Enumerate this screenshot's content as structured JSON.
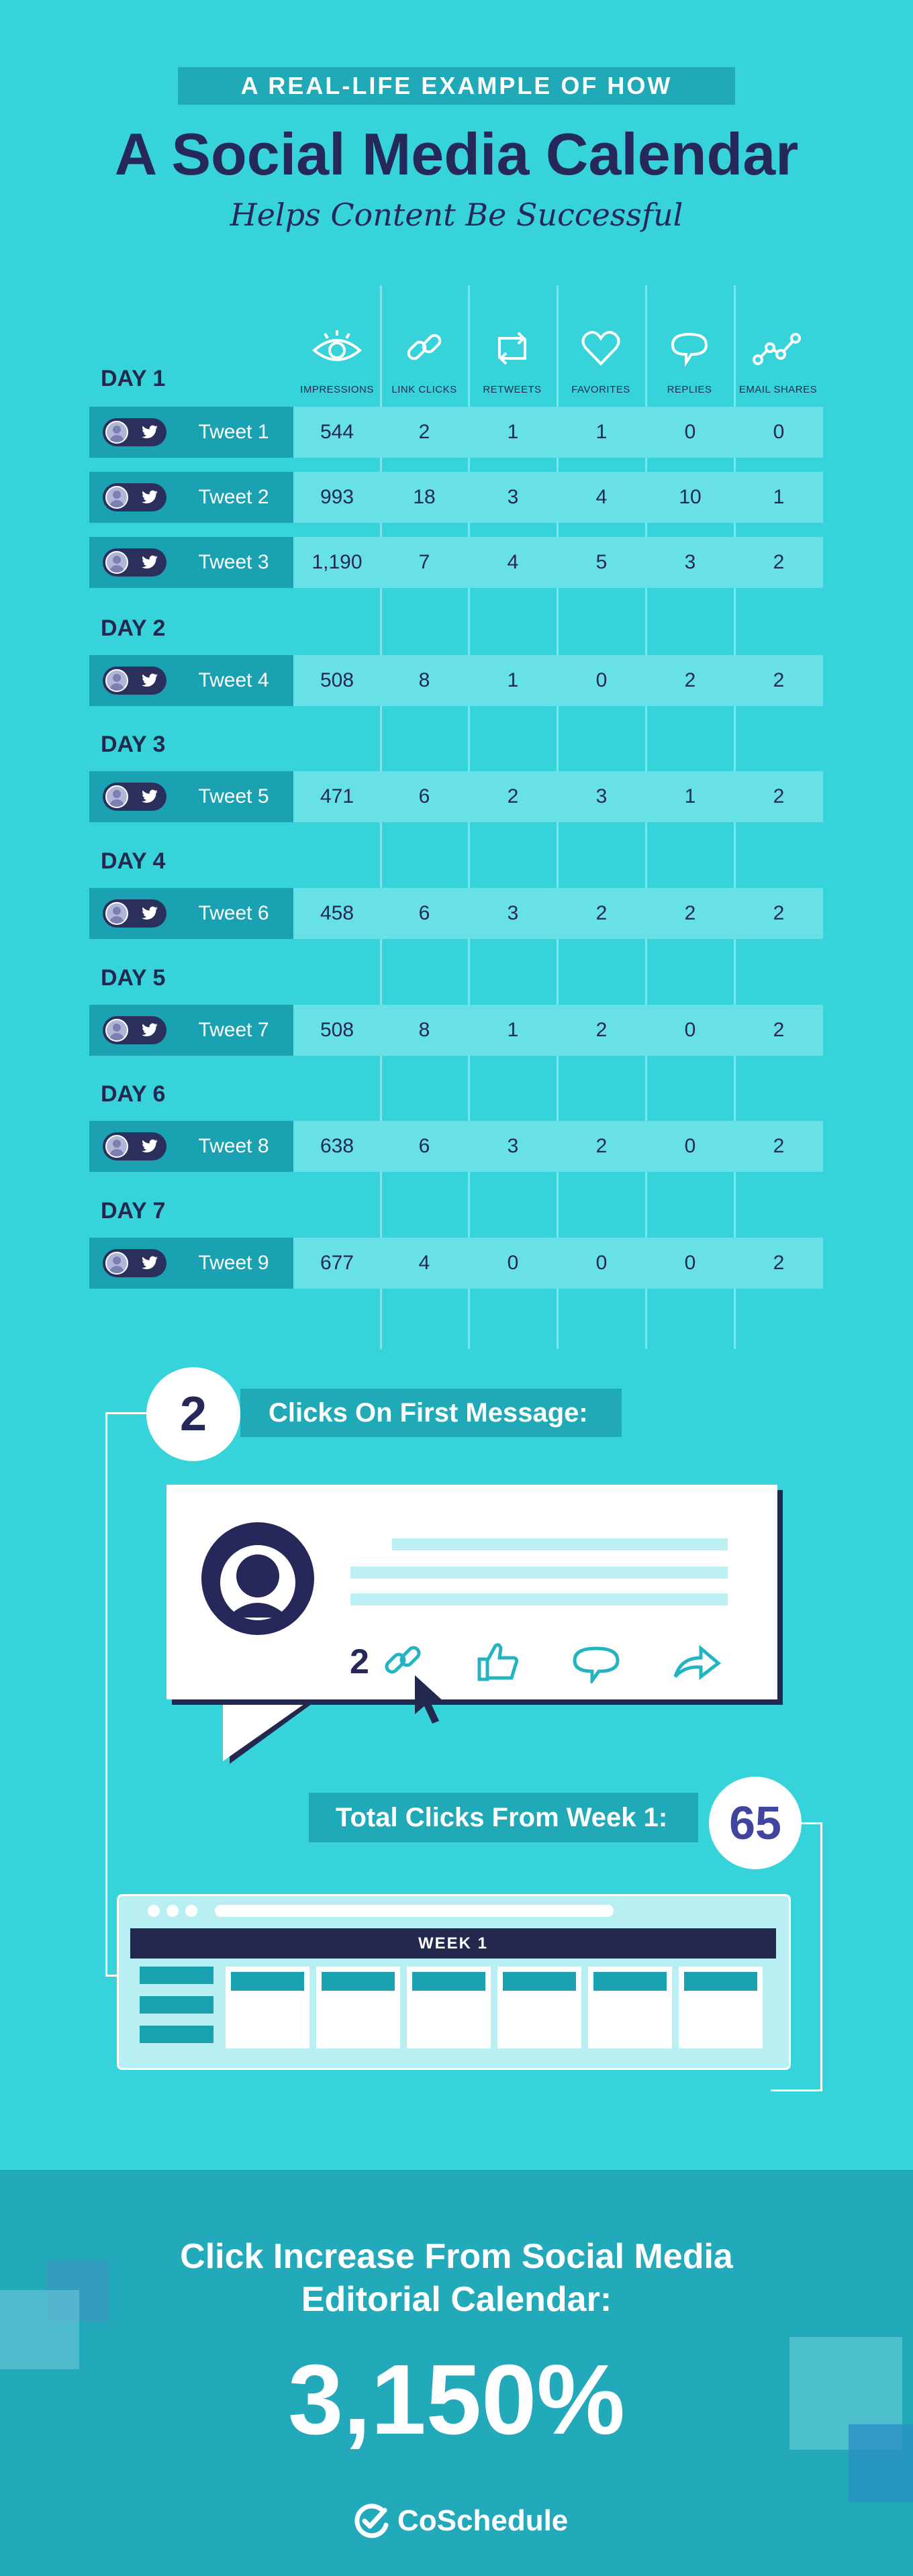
{
  "header": {
    "banner": "A REAL-LIFE EXAMPLE OF HOW",
    "title": "A Social Media Calendar",
    "subtitle": "Helps Content Be Successful"
  },
  "columns": [
    {
      "label": "IMPRESSIONS",
      "icon": "eye-icon"
    },
    {
      "label": "LINK CLICKS",
      "icon": "link-icon"
    },
    {
      "label": "RETWEETS",
      "icon": "retweet-icon"
    },
    {
      "label": "FAVORITES",
      "icon": "heart-icon"
    },
    {
      "label": "REPLIES",
      "icon": "speech-bubble-icon"
    },
    {
      "label": "EMAIL SHARES",
      "icon": "share-graph-icon"
    }
  ],
  "days": [
    {
      "label": "DAY 1",
      "tweets": [
        {
          "name": "Tweet 1",
          "values": [
            "544",
            "2",
            "1",
            "1",
            "0",
            "0"
          ]
        },
        {
          "name": "Tweet 2",
          "values": [
            "993",
            "18",
            "3",
            "4",
            "10",
            "1"
          ]
        },
        {
          "name": "Tweet 3",
          "values": [
            "1,190",
            "7",
            "4",
            "5",
            "3",
            "2"
          ]
        }
      ]
    },
    {
      "label": "DAY 2",
      "tweets": [
        {
          "name": "Tweet 4",
          "values": [
            "508",
            "8",
            "1",
            "0",
            "2",
            "2"
          ]
        }
      ]
    },
    {
      "label": "DAY 3",
      "tweets": [
        {
          "name": "Tweet 5",
          "values": [
            "471",
            "6",
            "2",
            "3",
            "1",
            "2"
          ]
        }
      ]
    },
    {
      "label": "DAY 4",
      "tweets": [
        {
          "name": "Tweet 6",
          "values": [
            "458",
            "6",
            "3",
            "2",
            "2",
            "2"
          ]
        }
      ]
    },
    {
      "label": "DAY 5",
      "tweets": [
        {
          "name": "Tweet 7",
          "values": [
            "508",
            "8",
            "1",
            "2",
            "0",
            "2"
          ]
        }
      ]
    },
    {
      "label": "DAY 6",
      "tweets": [
        {
          "name": "Tweet 8",
          "values": [
            "638",
            "6",
            "3",
            "2",
            "0",
            "2"
          ]
        }
      ]
    },
    {
      "label": "DAY 7",
      "tweets": [
        {
          "name": "Tweet 9",
          "values": [
            "677",
            "4",
            "0",
            "0",
            "0",
            "2"
          ]
        }
      ]
    }
  ],
  "first_message": {
    "count": "2",
    "label": "Clicks On First Message:",
    "card_clicks": "2"
  },
  "week_total": {
    "label": "Total Clicks From Week 1:",
    "value": "65",
    "calendar_label": "WEEK 1"
  },
  "footer": {
    "headline_line1": "Click Increase From Social Media",
    "headline_line2": "Editorial Calendar:",
    "percent": "3,150%",
    "brand": "CoSchedule"
  },
  "colors": {
    "background": "#37d3db",
    "navy": "#23284f",
    "teal_dark": "#1aa2b3",
    "row": "#68e1e6",
    "footer": "#22aabb"
  }
}
